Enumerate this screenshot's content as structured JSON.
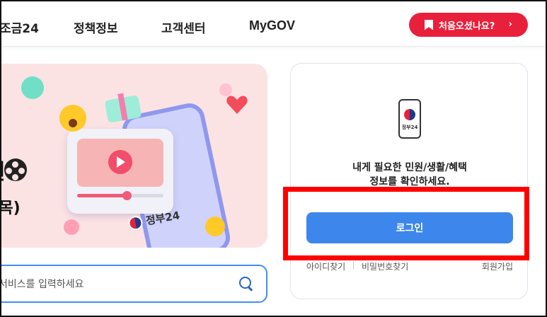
{
  "nav": {
    "items": [
      "조금24",
      "정책정보",
      "고객센터",
      "MyGOV"
    ],
    "first_visit_label": "처음오셨나요?",
    "first_visit_chevron": "›"
  },
  "banner": {
    "title_fragment": "현",
    "date_fragment": ".(목)",
    "logo_text": "정부24"
  },
  "search": {
    "placeholder": "서비스를 입력하세요"
  },
  "login": {
    "icon_label": "정부24",
    "desc_line1": "내게 필요한 민원/생활/혜택",
    "desc_line2": "정보를 확인하세요.",
    "button_label": "로그인",
    "find_id": "아이디찾기",
    "find_pw": "비밀번호찾기",
    "signup": "회원가입"
  },
  "colors": {
    "accent_red": "#e8203c",
    "login_blue": "#3d86ec",
    "search_border": "#3f8ef5",
    "highlight": "#ff0000"
  }
}
